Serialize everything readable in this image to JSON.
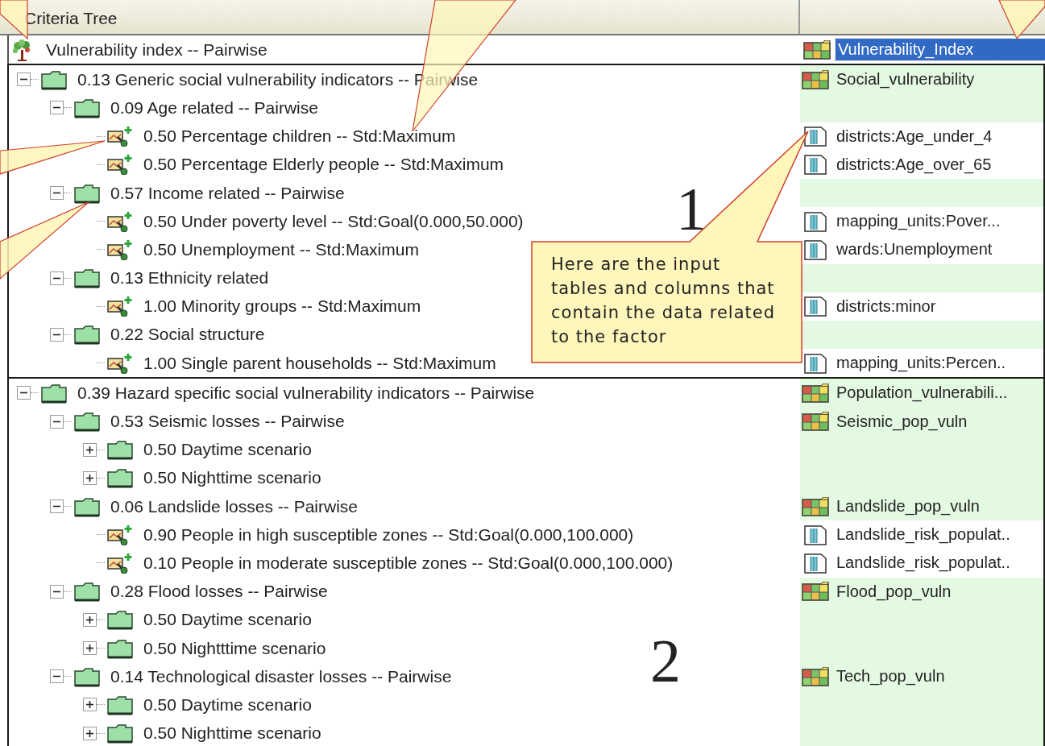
{
  "header": {
    "title": "Criteria Tree"
  },
  "root": {
    "label": "Vulnerability index -- Pairwise",
    "output": {
      "kind": "map",
      "text": "Vulnerability_Index",
      "selected": true
    }
  },
  "groups": [
    {
      "number": "1",
      "node": {
        "kind": "folder",
        "label": "0.13 Generic social vulnerability indicators -- Pairwise",
        "expanded": true,
        "output": {
          "kind": "map",
          "text": "Social_vulnerability"
        },
        "children": [
          {
            "kind": "folder",
            "label": "0.09 Age related -- Pairwise",
            "expanded": true,
            "children": [
              {
                "kind": "factor",
                "label": "0.50 Percentage children -- Std:Maximum",
                "output": {
                  "kind": "column",
                  "text": "districts:Age_under_4"
                }
              },
              {
                "kind": "factor",
                "label": "0.50 Percentage Elderly people -- Std:Maximum",
                "output": {
                  "kind": "column",
                  "text": "districts:Age_over_65"
                }
              }
            ]
          },
          {
            "kind": "folder",
            "label": "0.57 Income related -- Pairwise",
            "expanded": true,
            "children": [
              {
                "kind": "factor",
                "label": "0.50 Under poverty level -- Std:Goal(0.000,50.000)",
                "output": {
                  "kind": "column",
                  "text": "mapping_units:Pover..."
                }
              },
              {
                "kind": "factor",
                "label": "0.50 Unemployment -- Std:Maximum",
                "output": {
                  "kind": "column",
                  "text": "wards:Unemployment"
                }
              }
            ]
          },
          {
            "kind": "folder",
            "label": "0.13 Ethnicity related",
            "expanded": true,
            "children": [
              {
                "kind": "factor",
                "label": "1.00 Minority groups -- Std:Maximum",
                "output": {
                  "kind": "column",
                  "text": "districts:minor"
                }
              }
            ]
          },
          {
            "kind": "folder",
            "label": "0.22 Social structure",
            "expanded": true,
            "children": [
              {
                "kind": "factor",
                "label": "1.00 Single parent households -- Std:Maximum",
                "output": {
                  "kind": "column",
                  "text": "mapping_units:Percen.."
                }
              }
            ]
          }
        ]
      }
    },
    {
      "number": "2",
      "node": {
        "kind": "folder",
        "label": "0.39 Hazard specific social vulnerability indicators -- Pairwise",
        "expanded": true,
        "output": {
          "kind": "map",
          "text": "Population_vulnerabili..."
        },
        "children": [
          {
            "kind": "folder",
            "label": "0.53 Seismic losses -- Pairwise",
            "expanded": true,
            "output": {
              "kind": "map",
              "text": "Seismic_pop_vuln"
            },
            "children": [
              {
                "kind": "folder",
                "label": "0.50 Daytime scenario",
                "expanded": false
              },
              {
                "kind": "folder",
                "label": "0.50 Nighttime scenario",
                "expanded": false
              }
            ]
          },
          {
            "kind": "folder",
            "label": "0.06 Landslide losses -- Pairwise",
            "expanded": true,
            "output": {
              "kind": "map",
              "text": "Landslide_pop_vuln"
            },
            "children": [
              {
                "kind": "factor",
                "label": "0.90 People in high susceptible zones -- Std:Goal(0.000,100.000)",
                "output": {
                  "kind": "column",
                  "text": "Landslide_risk_populat.."
                }
              },
              {
                "kind": "factor",
                "label": "0.10 People in moderate susceptible zones -- Std:Goal(0.000,100.000)",
                "output": {
                  "kind": "column",
                  "text": "Landslide_risk_populat.."
                }
              }
            ]
          },
          {
            "kind": "folder",
            "label": "0.28 Flood losses -- Pairwise",
            "expanded": true,
            "output": {
              "kind": "map",
              "text": "Flood_pop_vuln"
            },
            "children": [
              {
                "kind": "folder",
                "label": "0.50 Daytime scenario",
                "expanded": false
              },
              {
                "kind": "folder",
                "label": "0.50 Nightttime scenario",
                "expanded": false
              }
            ]
          },
          {
            "kind": "folder",
            "label": "0.14 Technological disaster losses -- Pairwise",
            "expanded": true,
            "output": {
              "kind": "map",
              "text": "Tech_pop_vuln"
            },
            "children": [
              {
                "kind": "folder",
                "label": "0.50 Daytime scenario",
                "expanded": false
              },
              {
                "kind": "folder",
                "label": "0.50 Nighttime scenario",
                "expanded": false
              }
            ]
          }
        ]
      }
    }
  ],
  "callout": {
    "text": "Here are the input tables and columns that contain the data related to the factor"
  }
}
